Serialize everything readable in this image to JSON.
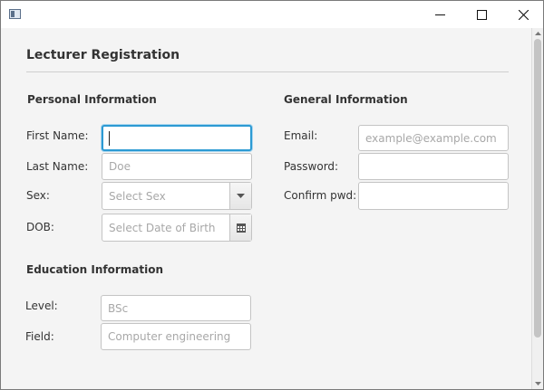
{
  "window": {
    "icon": "app-window-icon",
    "controls": [
      "minimize-icon",
      "maximize-icon",
      "close-icon"
    ]
  },
  "form": {
    "title": "Lecturer Registration",
    "personal": {
      "heading": "Personal Information",
      "first_name_label": "First Name:",
      "first_name_value": "",
      "last_name_label": "Last Name:",
      "last_name_placeholder": "Doe",
      "sex_label": "Sex:",
      "sex_placeholder": "Select Sex",
      "dob_label": "DOB:",
      "dob_placeholder": "Select Date of Birth"
    },
    "general": {
      "heading": "General Information",
      "email_label": "Email:",
      "email_placeholder": "example@example.com",
      "password_label": "Password:",
      "confirm_label": "Confirm pwd:"
    },
    "education": {
      "heading": "Education Information",
      "level_label": "Level:",
      "level_placeholder": "BSc",
      "field_label": "Field:",
      "field_placeholder": "Computer engineering"
    }
  },
  "colors": {
    "focus": "#2c9ad3",
    "background": "#f4f4f4"
  }
}
